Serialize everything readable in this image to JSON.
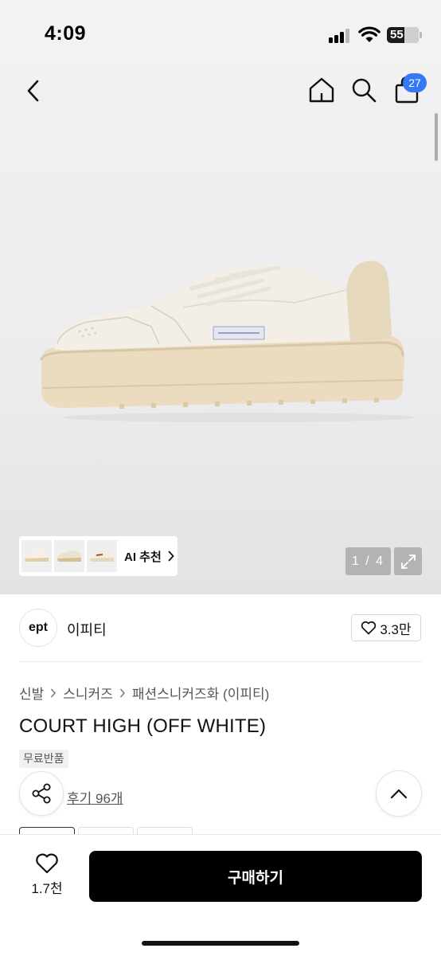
{
  "status_bar": {
    "time": "4:09",
    "battery": "55"
  },
  "nav": {
    "cart_count": "27"
  },
  "gallery": {
    "ai_recommend_label": "AI 추천",
    "counter": "1 / 4"
  },
  "brand": {
    "logo_text": "ept",
    "name": "이피티",
    "likes": "3.3만"
  },
  "product": {
    "breadcrumb": [
      "신발",
      "스니커즈",
      "패션스니커즈화 (이피티)"
    ],
    "title": "COURT HIGH (OFF WHITE)",
    "badge": "무료반품",
    "review_link": "후기 96개"
  },
  "bottom_bar": {
    "wish_count": "1.7천",
    "buy_label": "구매하기"
  },
  "colors": {
    "badge_blue": "#3478f6",
    "buy_button": "#000000"
  }
}
